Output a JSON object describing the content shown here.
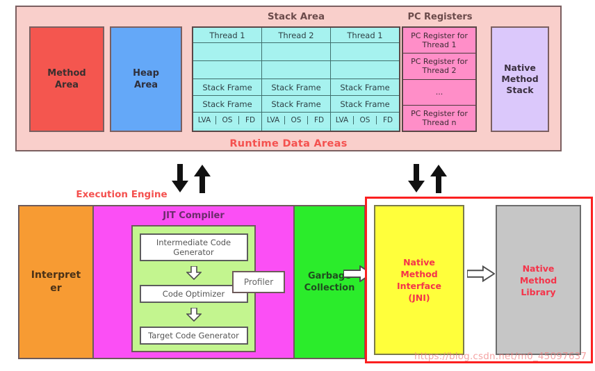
{
  "runtime_data_areas": {
    "label": "Runtime Data Areas",
    "method_area": "Method\nArea",
    "method_area_line1": "Method",
    "method_area_line2": "Area",
    "heap_area_line1": "Heap",
    "heap_area_line2": "Area",
    "stack_area_title": "Stack Area",
    "stack_columns": [
      {
        "thread": "Thread 1",
        "empty_rows": 2,
        "frames": [
          "Stack Frame",
          "Stack Frame"
        ],
        "parts": [
          "LVA",
          "OS",
          "FD"
        ]
      },
      {
        "thread": "Thread 2",
        "empty_rows": 2,
        "frames": [
          "Stack Frame",
          "Stack Frame"
        ],
        "parts": [
          "LVA",
          "OS",
          "FD"
        ]
      },
      {
        "thread": "Thread 1",
        "empty_rows": 2,
        "frames": [
          "Stack Frame",
          "Stack Frame"
        ],
        "parts": [
          "LVA",
          "OS",
          "FD"
        ]
      }
    ],
    "pc_registers_title": "PC Registers",
    "pc_registers": [
      "PC Register for Thread 1",
      "PC Register for Thread 2",
      "...",
      "PC Register for Thread n"
    ],
    "native_method_stack_line1": "Native",
    "native_method_stack_line2": "Method",
    "native_method_stack_line3": "Stack"
  },
  "execution_engine": {
    "label": "Execution Engine",
    "interpreter_line1": "Interpret",
    "interpreter_line2": "er",
    "jit_title": "JIT Compiler",
    "jit_stages": [
      "Intermediate Code Generator",
      "Code Optimizer",
      "Target Code Generator"
    ],
    "profiler": "Profiler",
    "garbage_collection_line1": "Garbage",
    "garbage_collection_line2": "Collection"
  },
  "native": {
    "jni_line1": "Native",
    "jni_line2": "Method",
    "jni_line3": "Interface",
    "jni_line4": "(JNI)",
    "library_line1": "Native",
    "library_line2": "Method",
    "library_line3": "Library"
  },
  "watermark": "https://blog.csdn.net/m0_45097637",
  "colors": {
    "runtime_bg": "#f9cfcb",
    "method_area": "#f4564f",
    "heap_area": "#64a8f8",
    "stack": "#a6f2ef",
    "pc_register": "#ff8ec8",
    "native_method_stack": "#dbc8fb",
    "interpreter": "#f79b33",
    "jit": "#fb4ff5",
    "jit_inner": "#c3f58f",
    "garbage_collection": "#2bec2b",
    "jni": "#ffff3b",
    "native_library": "#c6c6c6",
    "accent_red": "#f4514f",
    "native_border": "#fb2020"
  }
}
